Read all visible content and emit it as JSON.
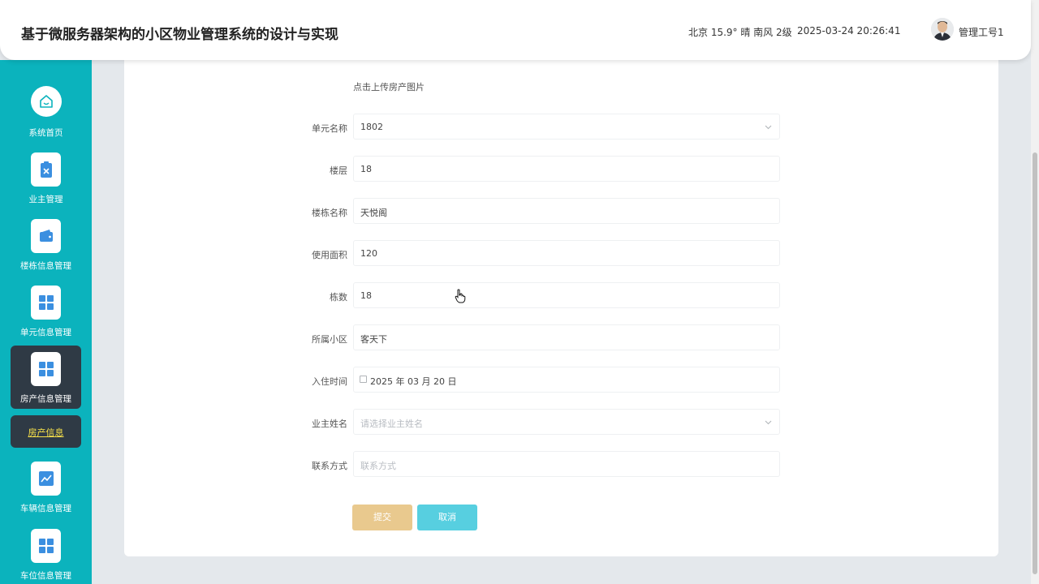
{
  "header": {
    "title": "基于微服务器架构的小区物业管理系统的设计与实现",
    "weather": "北京  15.9°  晴  南风  2级",
    "datetime": "2025-03-24 20:26:41",
    "username": "管理工号1"
  },
  "sidebar": {
    "items": [
      {
        "label": "系统首页",
        "icon": "home-icon"
      },
      {
        "label": "业主管理",
        "icon": "clipboard-icon"
      },
      {
        "label": "楼栋信息管理",
        "icon": "wallet-icon"
      },
      {
        "label": "单元信息管理",
        "icon": "grid-icon"
      },
      {
        "label": "房产信息管理",
        "icon": "grid-icon"
      },
      {
        "label": "车辆信息管理",
        "icon": "chart-icon"
      },
      {
        "label": "车位信息管理",
        "icon": "grid-icon"
      }
    ],
    "sub_item": "房产信息"
  },
  "form": {
    "upload_hint": "点击上传房产图片",
    "fields": [
      {
        "label": "单元名称",
        "value": "1802"
      },
      {
        "label": "楼层",
        "value": "18"
      },
      {
        "label": "楼栋名称",
        "value": "天悦阁"
      },
      {
        "label": "使用面积",
        "value": "120"
      },
      {
        "label": "栋数",
        "value": "18"
      },
      {
        "label": "所属小区",
        "value": "客天下"
      },
      {
        "label": "入住时间",
        "value": "2025 年 03 月 20 日"
      },
      {
        "label": "业主姓名",
        "placeholder": "请选择业主姓名"
      },
      {
        "label": "联系方式",
        "placeholder": "联系方式"
      }
    ],
    "submit_label": "提交",
    "cancel_label": "取消"
  },
  "colors": {
    "sidebar_bg": "#0bb3bd",
    "active_bg": "#2f3a45",
    "submit": "#e9c98e",
    "cancel": "#57cfe0",
    "sub_item_text": "#f6e04a"
  }
}
